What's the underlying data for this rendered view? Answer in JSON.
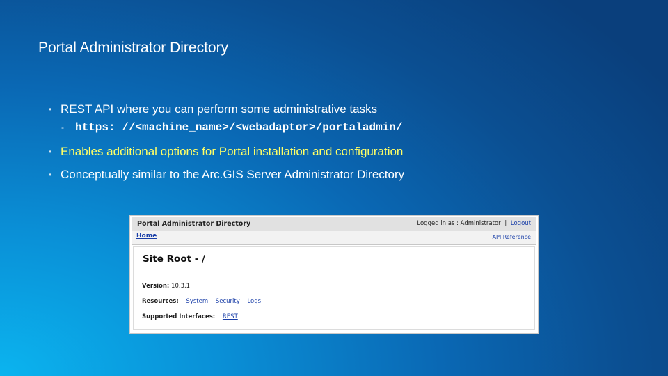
{
  "slide": {
    "title": "Portal Administrator Directory",
    "bullets": [
      "REST API where you can perform some administrative tasks",
      "Enables additional options for Portal installation and configuration",
      "Conceptually similar to the Arc.GIS Server Administrator Directory"
    ],
    "sub_bullet": "https: //<machine_name>/<webadaptor>/portaladmin/",
    "bullet_marker": "•",
    "sub_marker": "-",
    "highlight_color": "#ffff66"
  },
  "screenshot": {
    "header_title": "Portal Administrator Directory",
    "logged_in_text": "Logged in as : Administrator",
    "separator": "|",
    "logout_label": "Logout",
    "home_label": "Home",
    "api_reference_label": "API Reference",
    "page_heading": "Site Root - /",
    "version_label": "Version:",
    "version_value": "10.3.1",
    "resources_label": "Resources:",
    "resources": [
      "System",
      "Security",
      "Logs"
    ],
    "interfaces_label": "Supported Interfaces:",
    "interfaces": [
      "REST"
    ]
  }
}
